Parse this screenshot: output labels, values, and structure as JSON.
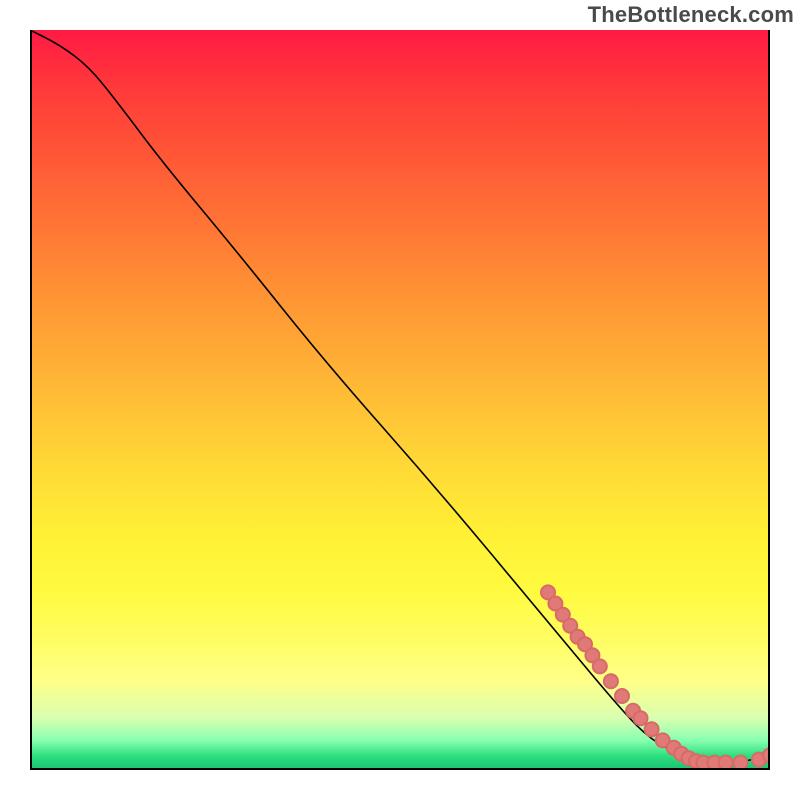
{
  "watermark": "TheBottleneck.com",
  "chart_data": {
    "type": "line",
    "title": "",
    "xlabel": "",
    "ylabel": "",
    "xlim": [
      0,
      100
    ],
    "ylim": [
      0,
      100
    ],
    "grid": false,
    "legend": false,
    "series": [
      {
        "name": "curve",
        "x": [
          0,
          4,
          8,
          12,
          18,
          28,
          40,
          55,
          70,
          80,
          84,
          88,
          92,
          96,
          100
        ],
        "y": [
          100,
          98,
          95,
          90,
          82,
          70,
          55,
          38,
          20,
          8,
          4,
          2,
          1,
          1,
          2
        ],
        "stroke": "#000000",
        "stroke_width": 1.6
      }
    ],
    "markers": {
      "stroke": "#d86a66",
      "fill": "#e07a78",
      "radius": 7,
      "points_xy": [
        [
          70,
          24
        ],
        [
          71,
          22.5
        ],
        [
          72,
          21
        ],
        [
          73,
          19.5
        ],
        [
          74,
          18
        ],
        [
          75,
          17
        ],
        [
          76,
          15.5
        ],
        [
          77,
          14
        ],
        [
          78.5,
          12
        ],
        [
          80,
          10
        ],
        [
          81.5,
          8
        ],
        [
          82.5,
          7
        ],
        [
          84,
          5.5
        ],
        [
          85.5,
          4
        ],
        [
          87,
          3
        ],
        [
          88,
          2.2
        ],
        [
          89,
          1.6
        ],
        [
          90,
          1.2
        ],
        [
          91,
          1
        ],
        [
          92.5,
          1
        ],
        [
          94,
          1
        ],
        [
          96,
          1
        ],
        [
          98.5,
          1.4
        ],
        [
          100,
          2
        ]
      ]
    }
  }
}
